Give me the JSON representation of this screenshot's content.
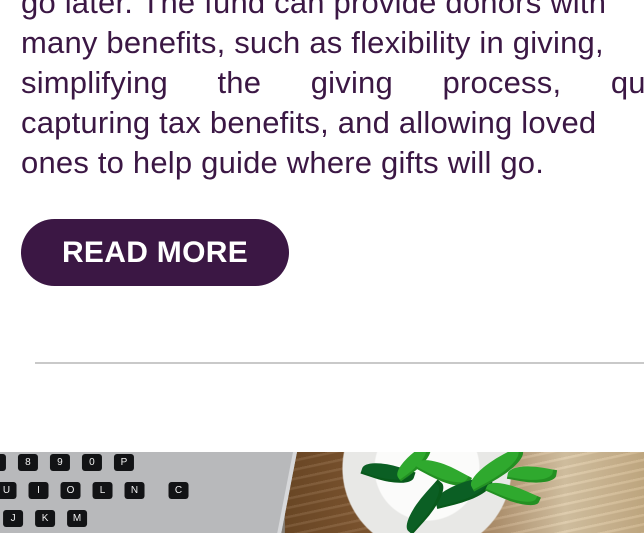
{
  "article": {
    "paragraph_lines": [
      "go later. The fund can provide donors with",
      "many benefits, such as flexibility in giving,",
      "simplifying the giving process, quickly",
      "capturing tax benefits, and allowing loved",
      "ones to help guide where gifts will go."
    ]
  },
  "actions": {
    "read_more_label": "READ MORE"
  },
  "image": {
    "keyboard_keys": [
      "7",
      "8",
      "9",
      "0",
      "P",
      "U",
      "I",
      "O",
      "L",
      "N",
      "K",
      "J",
      "M",
      "C"
    ]
  },
  "colors": {
    "text": "#3b1744",
    "button": "#3b1744",
    "button_text": "#ffffff",
    "divider": "#c9c9c9"
  }
}
